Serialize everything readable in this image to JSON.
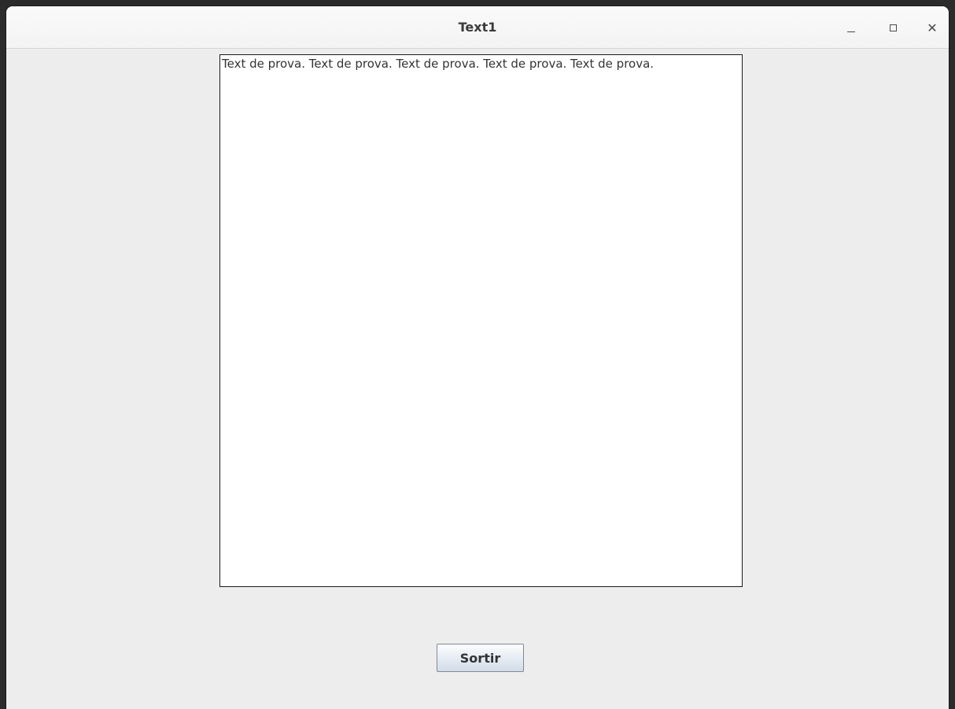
{
  "window": {
    "title": "Text1"
  },
  "title_buttons": {
    "minimize": "minimize-icon",
    "maximize": "maximize-icon",
    "close_glyph": "✕"
  },
  "text_area": {
    "content": "Text de prova. Text de prova. Text de prova. Text de prova. Text de prova."
  },
  "button": {
    "label": "Sortir"
  },
  "colors": {
    "background": "#ededed",
    "titlebar": "#f6f6f6",
    "text": "#333333"
  }
}
